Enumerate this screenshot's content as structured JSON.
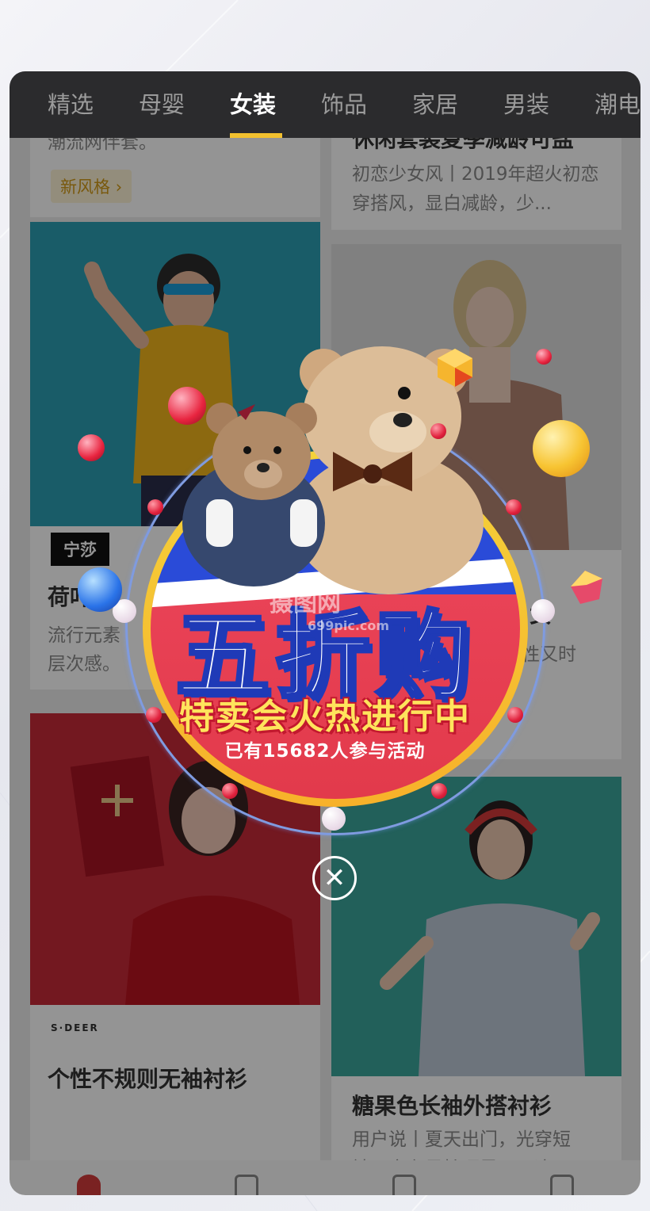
{
  "tabs": [
    "精选",
    "母婴",
    "女装",
    "饰品",
    "家居",
    "男装",
    "潮电"
  ],
  "active_tab_index": 2,
  "cards": {
    "top_left": {
      "partial_text": "潮流网伴套。",
      "tag": "新风格"
    },
    "top_right": {
      "partial_title": "休闲套装夏季减龄可盐",
      "desc": "初恋少女风丨2019年超火初恋穿搭风，显白减龄，少..."
    },
    "mid_left": {
      "brand": "宁莎",
      "title": "荷叶边",
      "desc": "流行元素",
      "desc2": "层次感。"
    },
    "mid_right": {
      "title_end": "女",
      "desc_end": "性又时"
    },
    "bottom_left": {
      "brand": "S·DEER",
      "title": "个性不规则无袖衬衫"
    },
    "bottom_right": {
      "title": "糖果色长袖外搭衬衫",
      "desc": "用户说丨夏天出门，光穿短袖，实在是怕晒黑了，这..."
    }
  },
  "popup": {
    "headline": "五折购",
    "subtitle": "特卖会火热进行中",
    "participants": "已有15682人参与活动",
    "watermark": "摄图网",
    "watermark_url": "699pic.com",
    "close_symbol": "✕"
  },
  "colors": {
    "accent_yellow": "#f2c02e",
    "medal_blue": "#2a4bd8",
    "medal_red": "#e23a4b",
    "subtitle_yellow": "#ffe45c"
  }
}
